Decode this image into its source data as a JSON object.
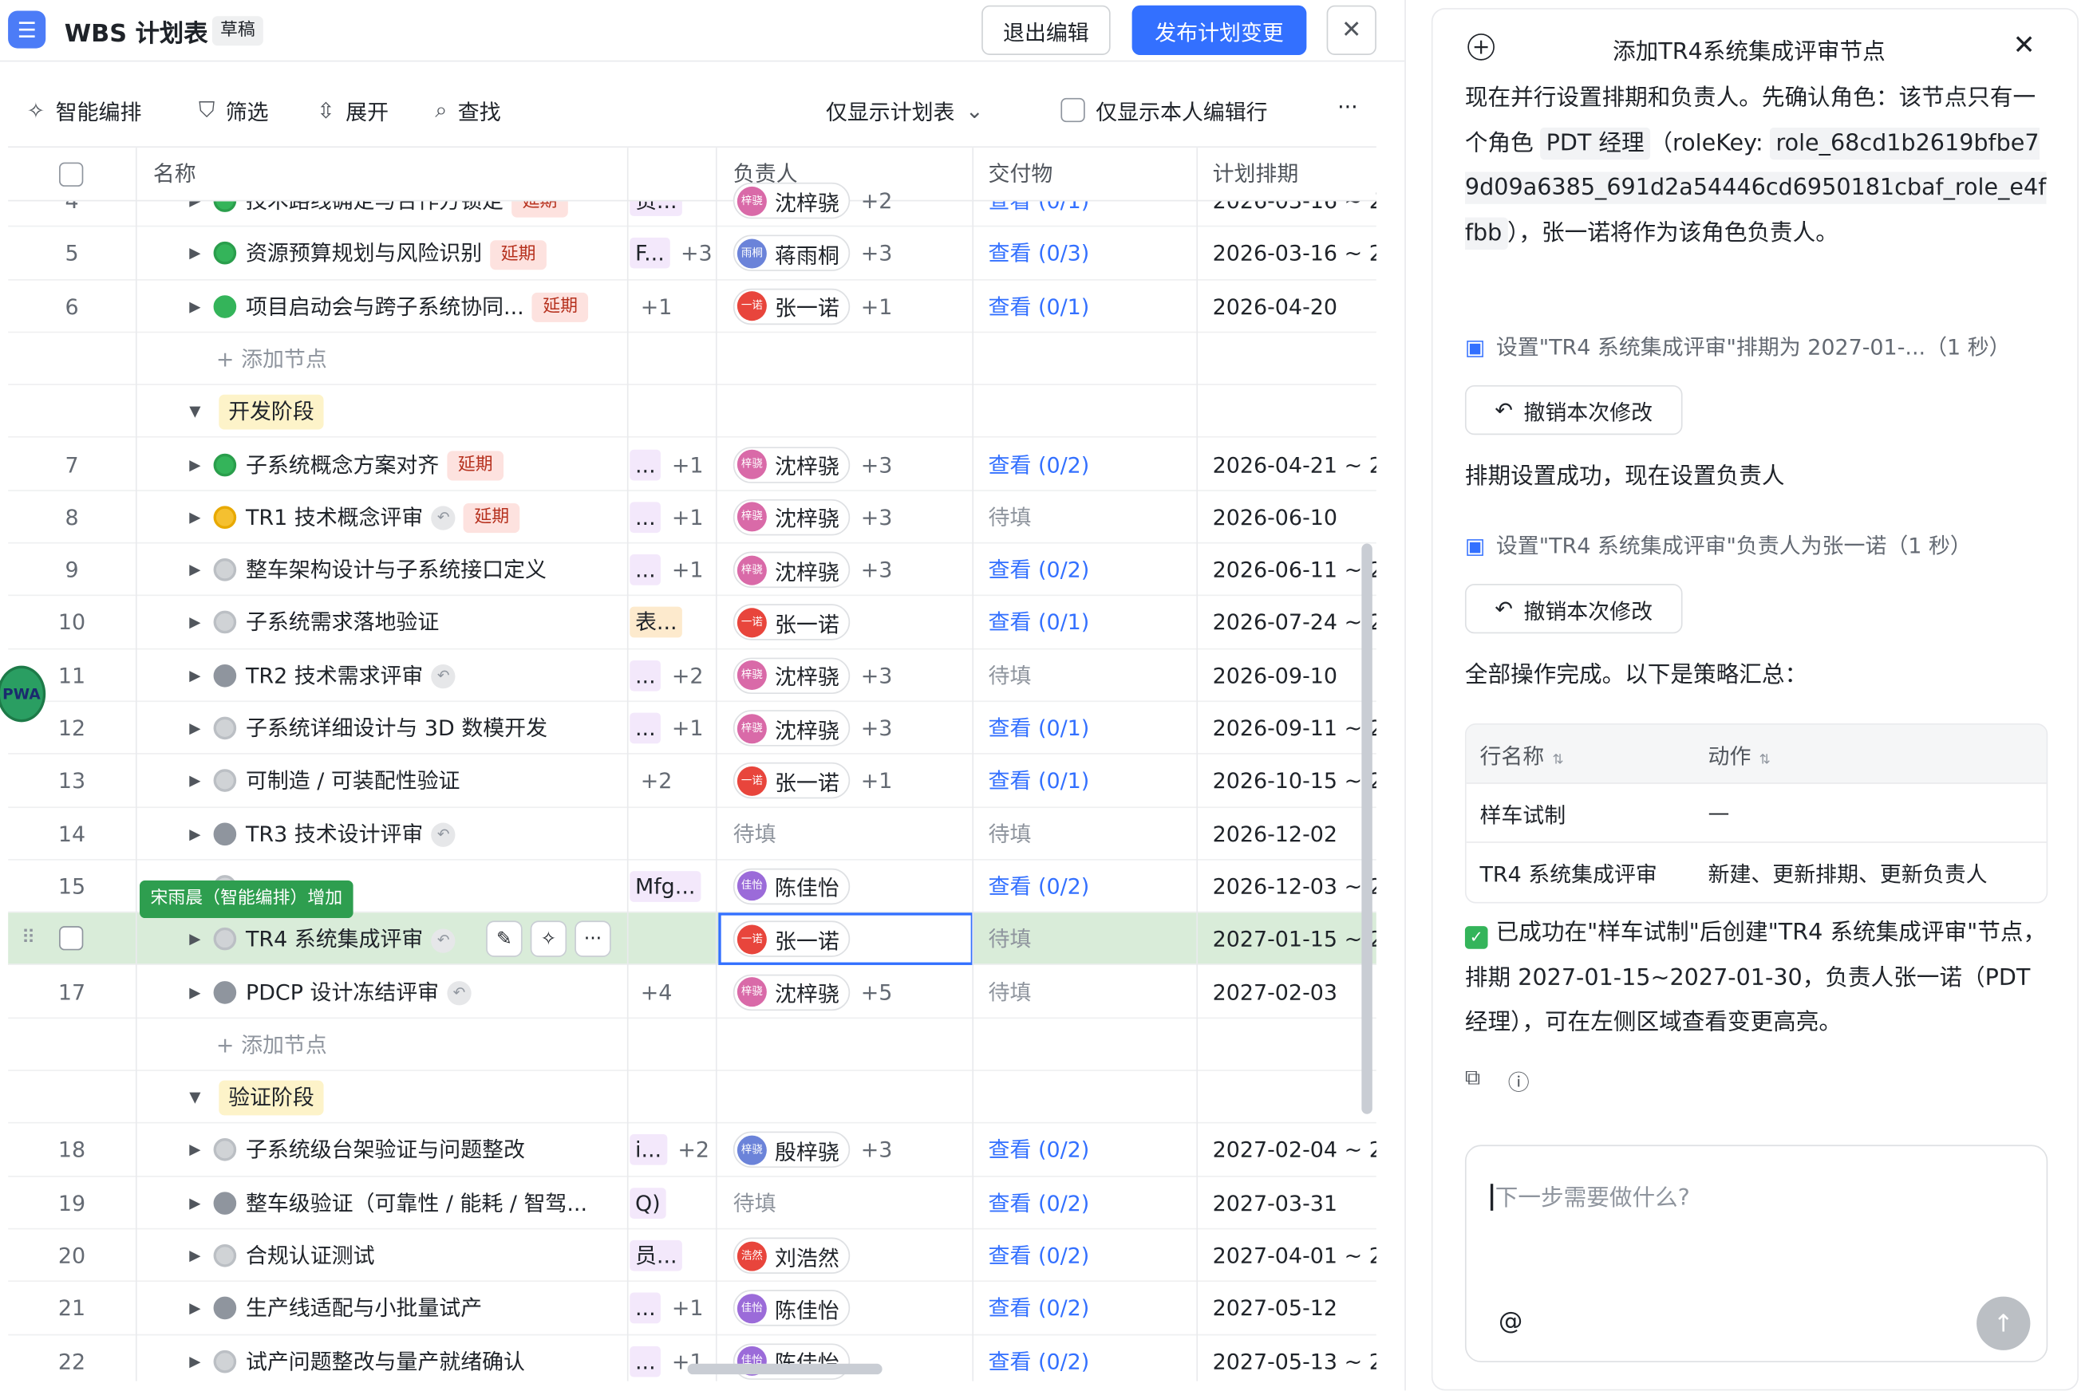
{
  "header": {
    "title": "WBS 计划表",
    "badge": "草稿",
    "exit_label": "退出编辑",
    "publish_label": "发布计划变更",
    "close_symbol": "✕"
  },
  "toolbar": {
    "smart": "智能编排",
    "filter": "筛选",
    "expand": "展开",
    "find": "查找",
    "view_select": "仅显示计划表",
    "only_mine": "仅显示本人编辑行",
    "more": "···"
  },
  "table": {
    "headers": {
      "name": "名称",
      "owner": "负责人",
      "deliverable": "交付物",
      "plan": "计划排期"
    },
    "rows": [
      {
        "kind": "task",
        "num": "4",
        "status": "green",
        "name": "技术路线确定与合作方锁定",
        "delay": "延期",
        "back": false,
        "c3": "责...",
        "c3plus": "",
        "owner": "沈梓骁",
        "owner_more": "+2",
        "av": "pink",
        "avtext": "梓骁",
        "deliv": "查看 (0/1)",
        "deliv_link": true,
        "plan": "2026-03-16 ~ 2"
      },
      {
        "kind": "task",
        "num": "5",
        "status": "green",
        "name": "资源预算规划与风险识别",
        "delay": "延期",
        "back": false,
        "c3": "F...",
        "c3plus": "+3",
        "owner": "蒋雨桐",
        "owner_more": "+3",
        "av": "blue",
        "avtext": "雨桐",
        "deliv": "查看 (0/3)",
        "deliv_link": true,
        "plan": "2026-03-16 ~ 2"
      },
      {
        "kind": "task",
        "num": "6",
        "status": "flag-green",
        "name": "项目启动会与跨子系统协同...",
        "delay": "延期",
        "back": false,
        "c3": "",
        "c3plus": "+1",
        "owner": "张一诺",
        "owner_more": "+1",
        "av": "red",
        "avtext": "一诺",
        "deliv": "查看 (0/1)",
        "deliv_link": true,
        "plan": "2026-04-20"
      },
      {
        "kind": "add",
        "label": "添加节点"
      },
      {
        "kind": "phase",
        "label": "开发阶段"
      },
      {
        "kind": "task",
        "num": "7",
        "status": "green",
        "name": "子系统概念方案对齐",
        "delay": "延期",
        "back": false,
        "c3": "...",
        "c3plus": "+1",
        "owner": "沈梓骁",
        "owner_more": "+3",
        "av": "pink",
        "avtext": "梓骁",
        "deliv": "查看 (0/2)",
        "deliv_link": true,
        "plan": "2026-04-21 ~ 2"
      },
      {
        "kind": "task",
        "num": "8",
        "status": "flag-yellow",
        "name": "TR1 技术概念评审",
        "delay": "延期",
        "back": true,
        "c3": "...",
        "c3plus": "+1",
        "owner": "沈梓骁",
        "owner_more": "+3",
        "av": "pink",
        "avtext": "梓骁",
        "deliv": "待填",
        "deliv_link": false,
        "plan": "2026-06-10"
      },
      {
        "kind": "task",
        "num": "9",
        "status": "grey",
        "name": "整车架构设计与子系统接口定义",
        "delay": "",
        "back": false,
        "c3": "...",
        "c3plus": "+1",
        "owner": "沈梓骁",
        "owner_more": "+3",
        "av": "pink",
        "avtext": "梓骁",
        "deliv": "查看 (0/2)",
        "deliv_link": true,
        "plan": "2026-06-11 ~ 2"
      },
      {
        "kind": "task",
        "num": "10",
        "status": "grey",
        "name": "子系统需求落地验证",
        "delay": "",
        "back": false,
        "c3": "表...",
        "c3plus": "",
        "c3or": true,
        "owner": "张一诺",
        "owner_more": "",
        "av": "red",
        "avtext": "一诺",
        "deliv": "查看 (0/1)",
        "deliv_link": true,
        "plan": "2026-07-24 ~ 2"
      },
      {
        "kind": "task",
        "num": "11",
        "status": "flag-grey",
        "name": "TR2 技术需求评审",
        "delay": "",
        "back": true,
        "c3": "...",
        "c3plus": "+2",
        "owner": "沈梓骁",
        "owner_more": "+3",
        "av": "pink",
        "avtext": "梓骁",
        "deliv": "待填",
        "deliv_link": false,
        "plan": "2026-09-10"
      },
      {
        "kind": "task",
        "num": "12",
        "status": "grey",
        "name": "子系统详细设计与 3D 数模开发",
        "delay": "",
        "back": false,
        "c3": "...",
        "c3plus": "+1",
        "owner": "沈梓骁",
        "owner_more": "+3",
        "av": "pink",
        "avtext": "梓骁",
        "deliv": "查看 (0/1)",
        "deliv_link": true,
        "plan": "2026-09-11 ~ 2"
      },
      {
        "kind": "task",
        "num": "13",
        "status": "grey",
        "name": "可制造 / 可装配性验证",
        "delay": "",
        "back": false,
        "c3": "",
        "c3plus": "+2",
        "owner": "张一诺",
        "owner_more": "+1",
        "av": "red",
        "avtext": "一诺",
        "deliv": "查看 (0/1)",
        "deliv_link": true,
        "plan": "2026-10-15 ~ 2"
      },
      {
        "kind": "task",
        "num": "14",
        "status": "flag-grey",
        "name": "TR3 技术设计评审",
        "delay": "",
        "back": true,
        "c3": "",
        "c3plus": "",
        "owner": "",
        "owner_pending": "待填",
        "owner_more": "",
        "av": "",
        "avtext": "",
        "deliv": "待填",
        "deliv_link": false,
        "plan": "2026-12-02"
      },
      {
        "kind": "task",
        "num": "15",
        "status": "grey",
        "name": "",
        "delay": "",
        "back": false,
        "c3": "Mfg...",
        "c3plus": "",
        "owner": "陈佳怡",
        "owner_more": "",
        "av": "purple",
        "avtext": "佳怡",
        "deliv": "查看 (0/2)",
        "deliv_link": true,
        "plan": "2026-12-03 ~ 2"
      },
      {
        "kind": "selected",
        "num": "",
        "status": "grey",
        "name": "TR4 系统集成评审",
        "back": true,
        "owner": "张一诺",
        "av": "red",
        "avtext": "一诺",
        "deliv": "待填",
        "plan": "2027-01-15 ~ 2"
      },
      {
        "kind": "task",
        "num": "17",
        "status": "flag-grey",
        "name": "PDCP 设计冻结评审",
        "delay": "",
        "back": true,
        "c3": "",
        "c3plus": "+4",
        "owner": "沈梓骁",
        "owner_more": "+5",
        "av": "pink",
        "avtext": "梓骁",
        "deliv": "待填",
        "deliv_link": false,
        "plan": "2027-02-03"
      },
      {
        "kind": "add",
        "label": "添加节点"
      },
      {
        "kind": "phase",
        "label": "验证阶段"
      },
      {
        "kind": "task",
        "num": "18",
        "status": "grey",
        "name": "子系统级台架验证与问题整改",
        "delay": "",
        "back": false,
        "c3": "i...",
        "c3plus": "+2",
        "owner": "殷梓骁",
        "owner_more": "+3",
        "av": "blue",
        "avtext": "梓骁",
        "deliv": "查看 (0/2)",
        "deliv_link": true,
        "plan": "2027-02-04 ~ 2"
      },
      {
        "kind": "task",
        "num": "19",
        "status": "flag-grey",
        "name": "整车级验证（可靠性 / 能耗 / 智驾...",
        "delay": "",
        "back": false,
        "c3": "Q)",
        "c3plus": "",
        "owner": "",
        "owner_pending": "待填",
        "owner_more": "",
        "av": "",
        "avtext": "",
        "deliv": "查看 (0/2)",
        "deliv_link": true,
        "plan": "2027-03-31"
      },
      {
        "kind": "task",
        "num": "20",
        "status": "grey",
        "name": "合规认证测试",
        "delay": "",
        "back": false,
        "c3": "员...",
        "c3plus": "",
        "owner": "刘浩然",
        "owner_more": "",
        "av": "red",
        "avtext": "浩然",
        "deliv": "查看 (0/2)",
        "deliv_link": true,
        "plan": "2027-04-01 ~ 2"
      },
      {
        "kind": "task",
        "num": "21",
        "status": "flag-grey",
        "name": "生产线适配与小批量试产",
        "delay": "",
        "back": false,
        "c3": "...",
        "c3plus": "+1",
        "owner": "陈佳怡",
        "owner_more": "",
        "av": "purple",
        "avtext": "佳怡",
        "deliv": "查看 (0/2)",
        "deliv_link": true,
        "plan": "2027-05-12"
      },
      {
        "kind": "task",
        "num": "22",
        "status": "grey",
        "name": "试产问题整改与量产就绪确认",
        "delay": "",
        "back": false,
        "c3": "...",
        "c3plus": "+1",
        "owner": "陈佳怡",
        "owner_more": "",
        "av": "purple",
        "avtext": "佳怡",
        "deliv": "查看 (0/2)",
        "deliv_link": true,
        "plan": "2027-05-13 ~ 2"
      }
    ]
  },
  "tooltip": "宋雨晨（智能编排）增加",
  "float_avatar": "PWA",
  "panel": {
    "title": "添加TR4系统集成评审节点",
    "msg1_a": "现在并行设置排期和负责人。先确认角色：该节点只有一个角色 ",
    "msg1_role": "PDT 经理",
    "msg1_b": "（roleKey: ",
    "msg1_key": "role_68cd1b2619bfbe79d09a6385_691d2a54446cd6950181cbaf_role_e4ffbb",
    "msg1_c": "），张一诺将作为该角色负责人。",
    "tool1": "设置\"TR4 系统集成评审\"排期为 2027-01-...（1 秒）",
    "undo": "撤销本次修改",
    "msg2": "排期设置成功，现在设置负责人",
    "tool2": "设置\"TR4 系统集成评审\"负责人为张一诺（1 秒）",
    "msg3": "全部操作完成。以下是策略汇总：",
    "summary": {
      "col_a": "行名称",
      "col_b": "动作",
      "rows": [
        {
          "a": "样车试制",
          "b": "—"
        },
        {
          "a": "TR4 系统集成评审",
          "b": "新建、更新排期、更新负责人"
        }
      ]
    },
    "final": "已成功在\"样车试制\"后创建\"TR4 系统集成评审\"节点，排期 2027-01-15~2027-01-30，负责人张一诺（PDT 经理），可在左侧区域查看变更高亮。",
    "input_placeholder": "下一步需要做什么?",
    "at": "@",
    "send": "↑"
  },
  "colors": {
    "accent": "#3370ff",
    "selected_row": "#d9ecd9",
    "delay_tag": "#fde2df",
    "phase_tag": "#fdf3c9"
  }
}
